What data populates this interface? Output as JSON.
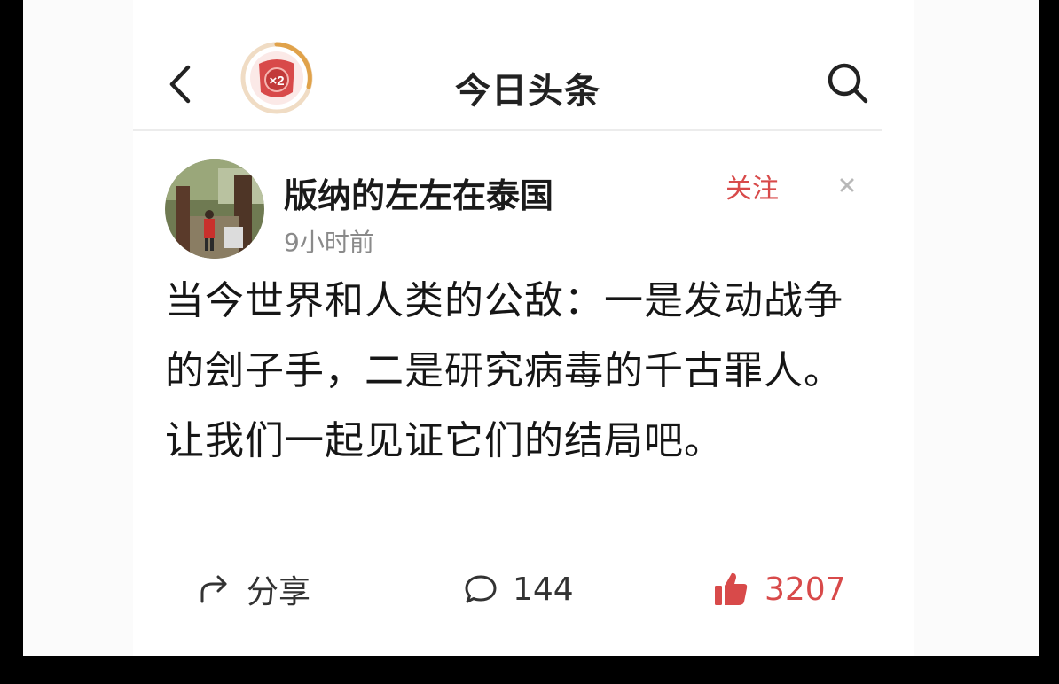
{
  "header": {
    "title": "今日头条",
    "badge_text": "×2",
    "icons": {
      "back": "chevron-left-icon",
      "search": "search-icon",
      "badge": "double-reward-badge-icon"
    }
  },
  "author": {
    "name": "版纳的左左在泰国",
    "time": "9小时前",
    "follow_label": "关注",
    "dismiss_icon": "close-icon"
  },
  "post": {
    "text": "当今世界和人类的公敌：一是发动战争的刽子手，二是研究病毒的千古罪人。让我们一起见证它们的结局吧。"
  },
  "actions": {
    "share": {
      "label": "分享",
      "icon": "share-arrow-icon"
    },
    "comment": {
      "count": "144",
      "icon": "comment-bubble-icon"
    },
    "like": {
      "count": "3207",
      "icon": "thumbs-up-icon"
    }
  },
  "colors": {
    "accent_red": "#d84a4a",
    "badge_ring": "#e0a24a",
    "text_primary": "#161616",
    "text_secondary": "#8a8a8a"
  }
}
